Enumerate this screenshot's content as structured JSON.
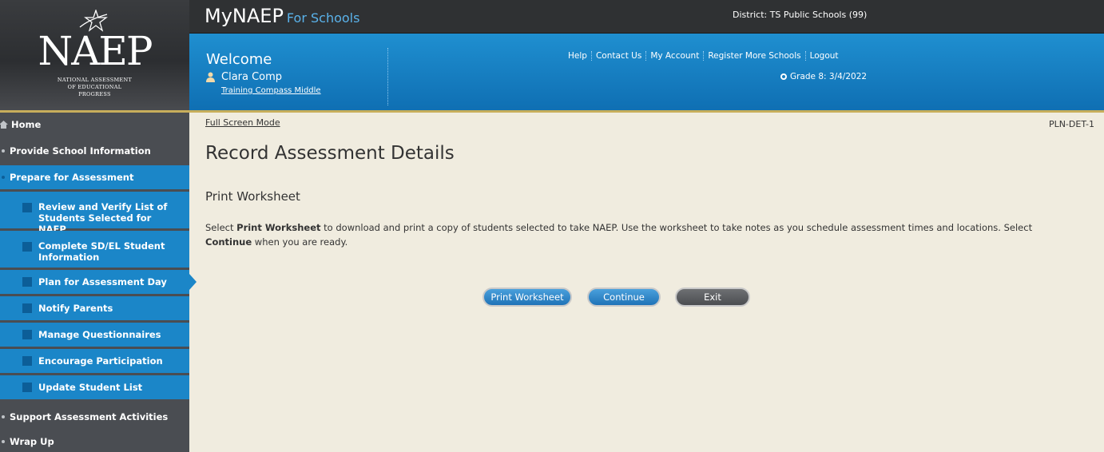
{
  "logo": {
    "name": "NAEP",
    "tagline": [
      "NATIONAL ASSESSMENT",
      "OF EDUCATIONAL",
      "PROGRESS"
    ]
  },
  "header": {
    "brand": "MyNAEP",
    "brand_suffix": "For Schools",
    "district": "District: TS Public Schools (99)",
    "welcome": "Welcome",
    "user_name": "Clara Comp",
    "school": "Training Compass Middle",
    "links": [
      "Help",
      "Contact Us",
      "My Account",
      "Register More Schools",
      "Logout"
    ],
    "grade": "Grade 8: 3/4/2022"
  },
  "sidebar": {
    "items": [
      {
        "label": "Home"
      },
      {
        "label": "Provide School Information"
      },
      {
        "label": "Prepare for Assessment"
      },
      {
        "label": "Review and Verify List of Students Selected for NAEP"
      },
      {
        "label": "Complete SD/EL Student Information"
      },
      {
        "label": "Plan for Assessment Day"
      },
      {
        "label": "Notify Parents"
      },
      {
        "label": "Manage Questionnaires"
      },
      {
        "label": "Encourage Participation"
      },
      {
        "label": "Update Student List"
      },
      {
        "label": "Support Assessment Activities"
      },
      {
        "label": "Wrap Up"
      }
    ]
  },
  "main": {
    "full_screen": "Full Screen Mode",
    "page_id": "PLN-DET-1",
    "title": "Record Assessment Details",
    "subtitle": "Print Worksheet",
    "desc_1": "Select ",
    "desc_b1": "Print Worksheet",
    "desc_2": " to download and print a copy of students selected to take NAEP. Use the worksheet to take notes as you schedule assessment times and locations. Select ",
    "desc_b2": "Continue",
    "desc_3": " when you are ready.",
    "buttons": {
      "print": "Print Worksheet",
      "continue": "Continue",
      "exit": "Exit"
    }
  },
  "colors": {
    "accent_blue": "#1b86c8",
    "header_dark": "#2f3133",
    "background": "#f0ecdf",
    "gold": "#c7ae5b"
  }
}
